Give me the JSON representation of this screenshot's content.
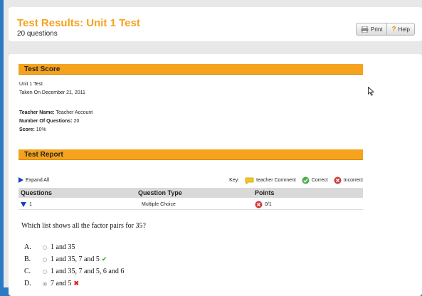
{
  "header": {
    "title": "Test Results: Unit 1 Test",
    "subtitle": "20 questions",
    "print_label": "Print",
    "help_label": "Help"
  },
  "score_section": {
    "title": "Test Score",
    "test_name": "Unit 1 Test",
    "taken_on": "Taken On December 21, 2011",
    "teacher_label": "Teacher Name:",
    "teacher_value": "Teacher Account",
    "num_questions_label": "Number Of Questions:",
    "num_questions_value": "20",
    "score_label": "Score:",
    "score_value": "10%"
  },
  "report_section": {
    "title": "Test Report",
    "expand_label": "Expand All",
    "key_label": "Key:",
    "key_items": [
      "teacher Comment",
      "Correct",
      "Incorrect"
    ],
    "columns": [
      "Questions",
      "Question Type",
      "Points"
    ],
    "rows": [
      {
        "number": "1",
        "type": "Multiple Choice",
        "points": "0/1"
      }
    ]
  },
  "question": {
    "text": "Which list shows all the factor pairs for 35?",
    "choices": [
      {
        "letter": "A.",
        "text": "1 and 35",
        "selected": false,
        "mark": ""
      },
      {
        "letter": "B.",
        "text": "1 and 35, 7 and 5",
        "selected": false,
        "mark": "correct"
      },
      {
        "letter": "C.",
        "text": "1 and 35, 7 and 5, 6 and 6",
        "selected": false,
        "mark": ""
      },
      {
        "letter": "D.",
        "text": "7 and 5",
        "selected": true,
        "mark": "incorrect"
      }
    ]
  },
  "colors": {
    "accent_orange": "#f5a21c",
    "window_blue": "#2a7bc1",
    "correct_green": "#2b9a2b",
    "incorrect_red": "#d22222"
  }
}
